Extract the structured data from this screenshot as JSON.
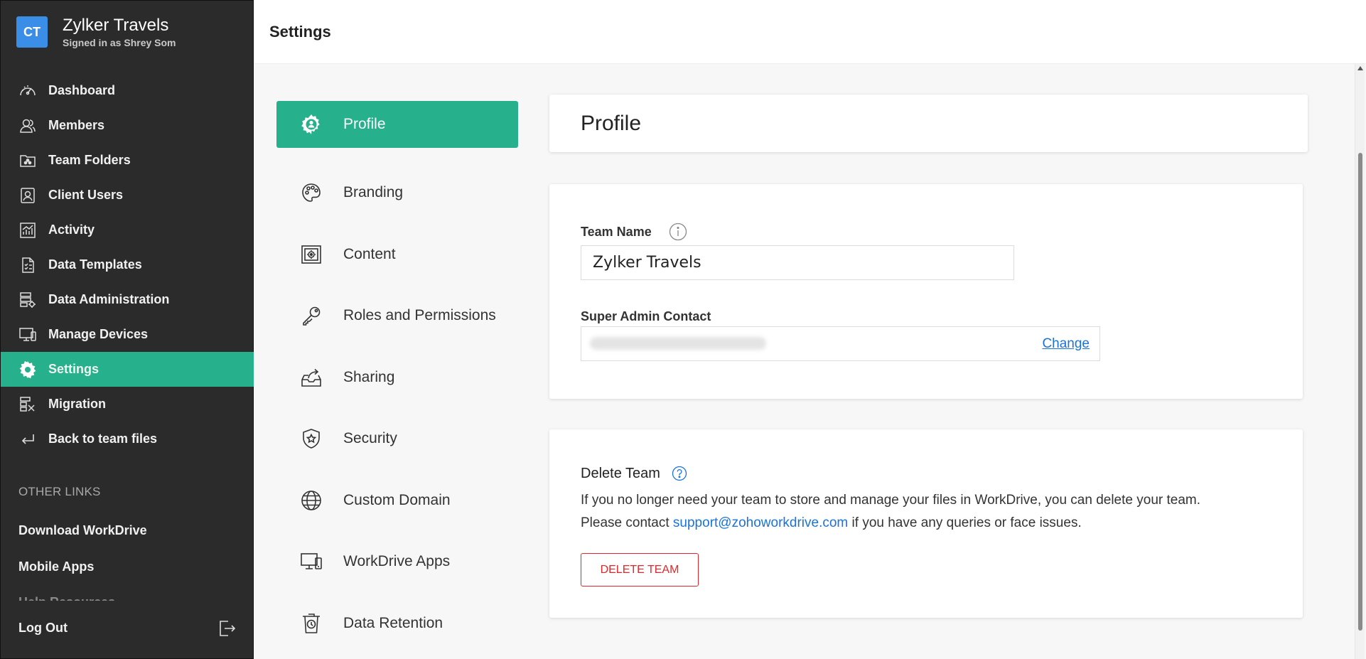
{
  "sidebar": {
    "team_initials": "CT",
    "team_name": "Zylker Travels",
    "signed_in": "Signed in as Shrey Som",
    "items": [
      {
        "label": "Dashboard",
        "icon": "dashboard-icon"
      },
      {
        "label": "Members",
        "icon": "members-icon"
      },
      {
        "label": "Team Folders",
        "icon": "team-folders-icon"
      },
      {
        "label": "Client Users",
        "icon": "client-users-icon"
      },
      {
        "label": "Activity",
        "icon": "activity-icon"
      },
      {
        "label": "Data Templates",
        "icon": "data-templates-icon"
      },
      {
        "label": "Data Administration",
        "icon": "data-administration-icon"
      },
      {
        "label": "Manage Devices",
        "icon": "manage-devices-icon"
      },
      {
        "label": "Settings",
        "icon": "settings-gear-icon",
        "active": true
      },
      {
        "label": "Migration",
        "icon": "migration-icon"
      },
      {
        "label": "Back to team files",
        "icon": "back-arrow-icon"
      }
    ],
    "other_links_title": "OTHER LINKS",
    "other_links": [
      "Download WorkDrive",
      "Mobile Apps"
    ],
    "cut_off_link": "Help Resources",
    "logout_label": "Log Out"
  },
  "header": {
    "title": "Settings"
  },
  "settings_menu": [
    {
      "label": "Profile",
      "icon": "profile-icon",
      "active": true
    },
    {
      "label": "Branding",
      "icon": "palette-icon"
    },
    {
      "label": "Content",
      "icon": "safe-icon"
    },
    {
      "label": "Roles and Permissions",
      "icon": "key-icon"
    },
    {
      "label": "Sharing",
      "icon": "share-icon"
    },
    {
      "label": "Security",
      "icon": "shield-icon"
    },
    {
      "label": "Custom Domain",
      "icon": "globe-icon"
    },
    {
      "label": "WorkDrive Apps",
      "icon": "devices-icon"
    },
    {
      "label": "Data Retention",
      "icon": "retention-icon"
    }
  ],
  "profile": {
    "title": "Profile",
    "team_name_label": "Team Name",
    "team_name_value": "Zylker Travels",
    "super_admin_label": "Super Admin Contact",
    "change_label": "Change",
    "delete_title": "Delete Team",
    "delete_line1": "If you no longer need your team to store and manage your files in WorkDrive, you can delete your team.",
    "delete_line2_pre": "Please contact ",
    "support_email": "support@zohoworkdrive.com",
    "delete_line2_post": " if you have any queries or face issues.",
    "delete_button": "DELETE TEAM"
  },
  "colors": {
    "sidebar_bg": "#2b2b2b",
    "accent": "#27b08c",
    "avatar": "#3a8ee8",
    "link": "#1a73d9",
    "danger": "#e0282c"
  }
}
